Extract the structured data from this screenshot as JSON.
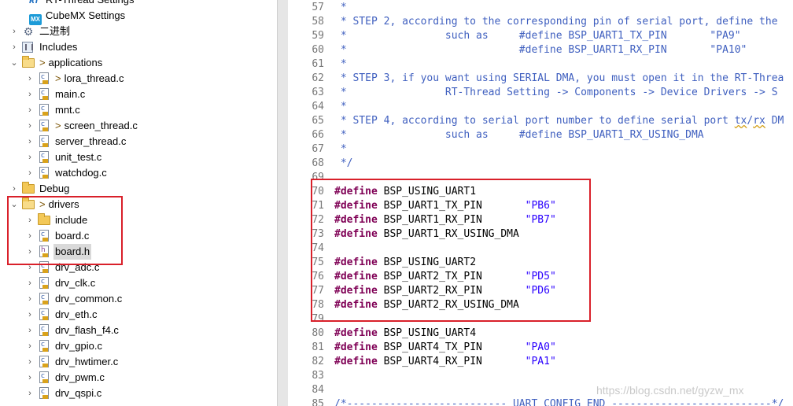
{
  "tree": {
    "items": [
      {
        "label": "RT-Thread Settings",
        "icon": "rt-thread-icon",
        "chevron": "",
        "indent": 0,
        "gt": false,
        "selected": false
      },
      {
        "label": "CubeMX Settings",
        "icon": "cubemx-icon",
        "chevron": "",
        "indent": 0,
        "gt": false,
        "selected": false
      },
      {
        "label": "二进制",
        "icon": "gear-icon",
        "chevron": "›",
        "indent": 0,
        "gt": false,
        "selected": false
      },
      {
        "label": "Includes",
        "icon": "library-icon",
        "chevron": "›",
        "indent": 0,
        "gt": false,
        "selected": false
      },
      {
        "label": "applications",
        "icon": "folder-open-icon",
        "chevron": "⌄",
        "indent": 0,
        "gt": true,
        "selected": false
      },
      {
        "label": "lora_thread.c",
        "icon": "c-file-icon",
        "chevron": "›",
        "indent": 1,
        "gt": true,
        "selected": false
      },
      {
        "label": "main.c",
        "icon": "c-file-icon",
        "chevron": "›",
        "indent": 1,
        "gt": false,
        "selected": false
      },
      {
        "label": "mnt.c",
        "icon": "c-file-icon",
        "chevron": "›",
        "indent": 1,
        "gt": false,
        "selected": false
      },
      {
        "label": "screen_thread.c",
        "icon": "c-file-icon",
        "chevron": "›",
        "indent": 1,
        "gt": true,
        "selected": false
      },
      {
        "label": "server_thread.c",
        "icon": "c-file-icon",
        "chevron": "›",
        "indent": 1,
        "gt": false,
        "selected": false
      },
      {
        "label": "unit_test.c",
        "icon": "c-file-icon",
        "chevron": "›",
        "indent": 1,
        "gt": false,
        "selected": false
      },
      {
        "label": "watchdog.c",
        "icon": "c-file-icon",
        "chevron": "›",
        "indent": 1,
        "gt": false,
        "selected": false
      },
      {
        "label": "Debug",
        "icon": "folder-icon",
        "chevron": "›",
        "indent": 0,
        "gt": false,
        "selected": false
      },
      {
        "label": "drivers",
        "icon": "folder-open-icon",
        "chevron": "⌄",
        "indent": 0,
        "gt": true,
        "selected": false
      },
      {
        "label": "include",
        "icon": "folder-icon",
        "chevron": "›",
        "indent": 1,
        "gt": false,
        "selected": false
      },
      {
        "label": "board.c",
        "icon": "c-file-icon",
        "chevron": "›",
        "indent": 1,
        "gt": false,
        "selected": false
      },
      {
        "label": "board.h",
        "icon": "h-file-icon",
        "chevron": "›",
        "indent": 1,
        "gt": false,
        "selected": true
      },
      {
        "label": "drv_adc.c",
        "icon": "c-file-icon",
        "chevron": "›",
        "indent": 1,
        "gt": false,
        "selected": false
      },
      {
        "label": "drv_clk.c",
        "icon": "c-file-icon",
        "chevron": "›",
        "indent": 1,
        "gt": false,
        "selected": false
      },
      {
        "label": "drv_common.c",
        "icon": "c-file-icon",
        "chevron": "›",
        "indent": 1,
        "gt": false,
        "selected": false
      },
      {
        "label": "drv_eth.c",
        "icon": "c-file-icon",
        "chevron": "›",
        "indent": 1,
        "gt": false,
        "selected": false
      },
      {
        "label": "drv_flash_f4.c",
        "icon": "c-file-icon",
        "chevron": "›",
        "indent": 1,
        "gt": false,
        "selected": false
      },
      {
        "label": "drv_gpio.c",
        "icon": "c-file-icon",
        "chevron": "›",
        "indent": 1,
        "gt": false,
        "selected": false
      },
      {
        "label": "drv_hwtimer.c",
        "icon": "c-file-icon",
        "chevron": "›",
        "indent": 1,
        "gt": false,
        "selected": false
      },
      {
        "label": "drv_pwm.c",
        "icon": "c-file-icon",
        "chevron": "›",
        "indent": 1,
        "gt": false,
        "selected": false
      },
      {
        "label": "drv_qspi.c",
        "icon": "c-file-icon",
        "chevron": "›",
        "indent": 1,
        "gt": false,
        "selected": false
      }
    ]
  },
  "editor": {
    "lines": [
      {
        "n": "57",
        "parts": [
          {
            "t": " *",
            "c": "cmt"
          }
        ]
      },
      {
        "n": "58",
        "parts": [
          {
            "t": " * STEP 2, according to the corresponding pin of serial port, define the",
            "c": "cmt"
          }
        ]
      },
      {
        "n": "59",
        "parts": [
          {
            "t": " *                such as     #define BSP_UART1_TX_PIN       \"PA9\"",
            "c": "cmt"
          }
        ]
      },
      {
        "n": "60",
        "parts": [
          {
            "t": " *                            #define BSP_UART1_RX_PIN       \"PA10\"",
            "c": "cmt"
          }
        ]
      },
      {
        "n": "61",
        "parts": [
          {
            "t": " *",
            "c": "cmt"
          }
        ]
      },
      {
        "n": "62",
        "parts": [
          {
            "t": " * STEP 3, if you want using SERIAL DMA, you must open it in the RT-Threa",
            "c": "cmt"
          }
        ]
      },
      {
        "n": "63",
        "parts": [
          {
            "t": " *                RT-Thread Setting -> Components -> Device Drivers -> S",
            "c": "cmt"
          }
        ]
      },
      {
        "n": "64",
        "parts": [
          {
            "t": " *",
            "c": "cmt"
          }
        ]
      },
      {
        "n": "65",
        "parts": [
          {
            "t": " * STEP 4, according to serial port number to define serial port ",
            "c": "cmt"
          },
          {
            "t": "tx",
            "c": "cmt squig"
          },
          {
            "t": "/",
            "c": "cmt"
          },
          {
            "t": "rx",
            "c": "cmt squig"
          },
          {
            "t": " DM",
            "c": "cmt"
          }
        ]
      },
      {
        "n": "66",
        "parts": [
          {
            "t": " *                such as     #define BSP_UART1_RX_USING_DMA",
            "c": "cmt"
          }
        ]
      },
      {
        "n": "67",
        "parts": [
          {
            "t": " *",
            "c": "cmt"
          }
        ]
      },
      {
        "n": "68",
        "parts": [
          {
            "t": " */",
            "c": "cmt"
          }
        ]
      },
      {
        "n": "69",
        "parts": []
      },
      {
        "n": "70",
        "parts": [
          {
            "t": "#define",
            "c": "kw"
          },
          {
            "t": " BSP_USING_UART1",
            "c": "plain"
          }
        ]
      },
      {
        "n": "71",
        "parts": [
          {
            "t": "#define",
            "c": "kw"
          },
          {
            "t": " BSP_UART1_TX_PIN       ",
            "c": "plain"
          },
          {
            "t": "\"PB6\"",
            "c": "str"
          }
        ]
      },
      {
        "n": "72",
        "parts": [
          {
            "t": "#define",
            "c": "kw"
          },
          {
            "t": " BSP_UART1_RX_PIN       ",
            "c": "plain"
          },
          {
            "t": "\"PB7\"",
            "c": "str"
          }
        ]
      },
      {
        "n": "73",
        "parts": [
          {
            "t": "#define",
            "c": "kw"
          },
          {
            "t": " BSP_UART1_RX_USING_DMA",
            "c": "plain"
          }
        ]
      },
      {
        "n": "74",
        "parts": []
      },
      {
        "n": "75",
        "parts": [
          {
            "t": "#define",
            "c": "kw"
          },
          {
            "t": " BSP_USING_UART2",
            "c": "plain"
          }
        ]
      },
      {
        "n": "76",
        "parts": [
          {
            "t": "#define",
            "c": "kw"
          },
          {
            "t": " BSP_UART2_TX_PIN       ",
            "c": "plain"
          },
          {
            "t": "\"PD5\"",
            "c": "str"
          }
        ]
      },
      {
        "n": "77",
        "parts": [
          {
            "t": "#define",
            "c": "kw"
          },
          {
            "t": " BSP_UART2_RX_PIN       ",
            "c": "plain"
          },
          {
            "t": "\"PD6\"",
            "c": "str"
          }
        ]
      },
      {
        "n": "78",
        "parts": [
          {
            "t": "#define",
            "c": "kw"
          },
          {
            "t": " BSP_UART2_RX_USING_DMA",
            "c": "plain"
          }
        ]
      },
      {
        "n": "79",
        "parts": []
      },
      {
        "n": "80",
        "parts": [
          {
            "t": "#define",
            "c": "kw"
          },
          {
            "t": " BSP_USING_UART4",
            "c": "plain"
          }
        ]
      },
      {
        "n": "81",
        "parts": [
          {
            "t": "#define",
            "c": "kw"
          },
          {
            "t": " BSP_UART4_TX_PIN       ",
            "c": "plain"
          },
          {
            "t": "\"PA0\"",
            "c": "str"
          }
        ]
      },
      {
        "n": "82",
        "parts": [
          {
            "t": "#define",
            "c": "kw"
          },
          {
            "t": " BSP_UART4_RX_PIN       ",
            "c": "plain"
          },
          {
            "t": "\"PA1\"",
            "c": "str"
          }
        ]
      },
      {
        "n": "83",
        "parts": []
      },
      {
        "n": "84",
        "parts": []
      },
      {
        "n": "85",
        "parts": [
          {
            "t": "/*-------------------------- UART CONFIG END --------------------------*/",
            "c": "cmt"
          }
        ]
      }
    ]
  },
  "watermark": "https://blog.csdn.net/gyzw_mx",
  "colors": {
    "highlight_box": "#d9202a",
    "keyword": "#7f0055",
    "string": "#2a00ff",
    "comment": "#3f5fbf"
  }
}
